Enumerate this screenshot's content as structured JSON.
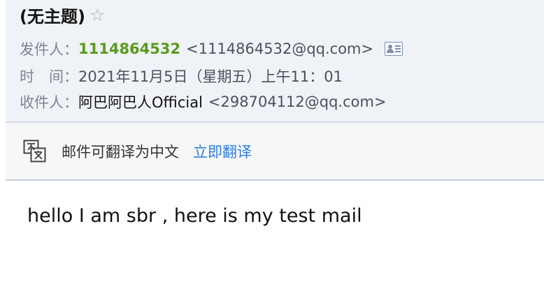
{
  "subject": "(无主题)",
  "star_icon": "star-outline-icon",
  "sender": {
    "label": "发件人：",
    "name": "1114864532",
    "address": "<1114864532@qq.com>",
    "contact_card_icon": "contact-card-icon"
  },
  "time": {
    "label": "时　间：",
    "value": "2021年11月5日（星期五）上午11：01"
  },
  "recipient": {
    "label": "收件人：",
    "name": "阿巴阿巴人Official",
    "address": "<298704112@qq.com>"
  },
  "translate": {
    "icon": "translate-icon",
    "text": "邮件可翻译为中文",
    "link": "立即翻译"
  },
  "body": {
    "text": "hello I am sbr , here is my test mail"
  },
  "colors": {
    "header_bg": "#eff2f6",
    "sender_name": "#5a9a1d",
    "link": "#2f7fd6",
    "label": "#7d8591"
  }
}
